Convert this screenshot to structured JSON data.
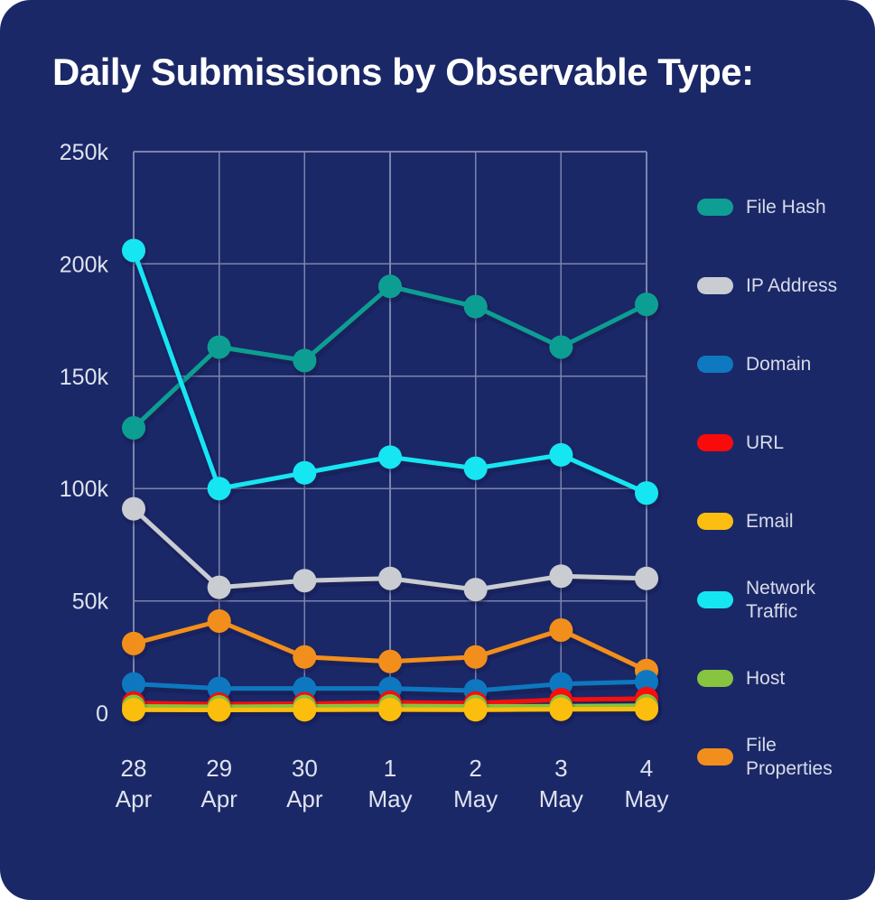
{
  "chart_data": {
    "type": "line",
    "title": "Daily Submissions by Observable Type:",
    "xlabel": "",
    "ylabel": "",
    "categories": [
      "28 Apr",
      "29 Apr",
      "30 Apr",
      "1 May",
      "2 May",
      "3 May",
      "4 May"
    ],
    "x_tick_lines": [
      {
        "day": "28",
        "month": "Apr"
      },
      {
        "day": "29",
        "month": "Apr"
      },
      {
        "day": "30",
        "month": "Apr"
      },
      {
        "day": "1",
        "month": "May"
      },
      {
        "day": "2",
        "month": "May"
      },
      {
        "day": "3",
        "month": "May"
      },
      {
        "day": "4",
        "month": "May"
      }
    ],
    "ylim": [
      0,
      250000
    ],
    "y_ticks": [
      0,
      50000,
      100000,
      150000,
      200000,
      250000
    ],
    "y_tick_labels": [
      "0",
      "50k",
      "100k",
      "150k",
      "200k",
      "250k"
    ],
    "grid": true,
    "legend_position": "right",
    "series": [
      {
        "name": "File Hash",
        "color": "#0f9e93",
        "values": [
          127000,
          163000,
          157000,
          190000,
          181000,
          163000,
          182000
        ]
      },
      {
        "name": "IP Address",
        "color": "#c9ccd1",
        "values": [
          91000,
          56000,
          59000,
          60000,
          55000,
          61000,
          60000
        ]
      },
      {
        "name": "Domain",
        "color": "#0e78c0",
        "values": [
          13000,
          11000,
          11000,
          11000,
          10000,
          13000,
          14000
        ]
      },
      {
        "name": "URL",
        "color": "#fa0b0b",
        "values": [
          4500,
          4000,
          4200,
          4800,
          4500,
          6000,
          6500
        ]
      },
      {
        "name": "Email",
        "color": "#fcbe11",
        "values": [
          1500,
          1400,
          1500,
          1600,
          1500,
          1700,
          1800
        ]
      },
      {
        "name": "Network Traffic",
        "color": "#16e6f2",
        "values": [
          206000,
          100000,
          107000,
          114000,
          109000,
          115000,
          98000
        ]
      },
      {
        "name": "Host",
        "color": "#87c440",
        "values": [
          3000,
          2800,
          3000,
          3200,
          3000,
          3100,
          3300
        ]
      },
      {
        "name": "File Properties",
        "color": "#f28f1c",
        "values": [
          31000,
          41000,
          25000,
          23000,
          25000,
          37000,
          19000
        ]
      }
    ]
  },
  "legend": {
    "items": [
      {
        "label": "File Hash",
        "color": "#0f9e93"
      },
      {
        "label": "IP Address",
        "color": "#c9ccd1"
      },
      {
        "label": "Domain",
        "color": "#0e78c0"
      },
      {
        "label": "URL",
        "color": "#fa0b0b"
      },
      {
        "label": "Email",
        "color": "#fcbe11"
      },
      {
        "label": "Network\nTraffic",
        "color": "#16e6f2"
      },
      {
        "label": "Host",
        "color": "#87c440"
      },
      {
        "label": "File\nProperties",
        "color": "#f28f1c"
      }
    ]
  },
  "theme": {
    "background": "#1b2868",
    "title_color": "#ffffff",
    "axis_text_color": "#dfe3ee",
    "grid_color": "#7b84ad"
  }
}
